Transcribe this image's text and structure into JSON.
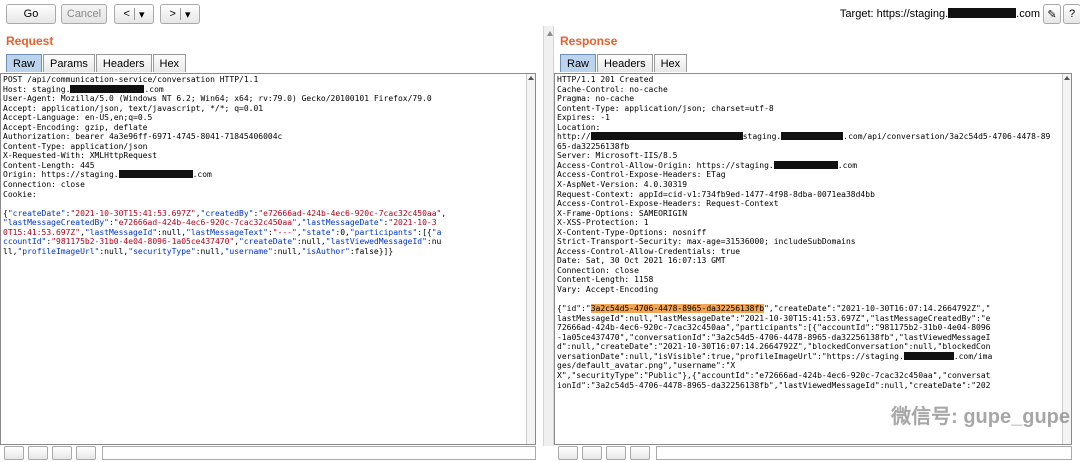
{
  "toolbar": {
    "go_label": "Go",
    "cancel_label": "Cancel",
    "back_label": "<",
    "back_menu_label": "▾",
    "forward_label": ">",
    "forward_menu_label": "▾",
    "target_prefix": "Target: https://staging.",
    "target_suffix": ".com"
  },
  "request": {
    "title": "Request",
    "tabs": [
      "Raw",
      "Params",
      "Headers",
      "Hex"
    ],
    "active_tab": "Raw",
    "lines": [
      {
        "parts": [
          {
            "t": "POST /api/communication-service/conversation HTTP/1.1"
          }
        ]
      },
      {
        "parts": [
          {
            "t": "Host: staging."
          },
          {
            "mask": 74
          },
          {
            "t": ".com"
          }
        ]
      },
      {
        "parts": [
          {
            "t": "User-Agent: Mozilla/5.0 (Windows NT 6.2; Win64; x64; rv:79.0) Gecko/20100101 Firefox/79.0"
          }
        ]
      },
      {
        "parts": [
          {
            "t": "Accept: application/json, text/javascript, */*; q=0.01"
          }
        ]
      },
      {
        "parts": [
          {
            "t": "Accept-Language: en-US,en;q=0.5"
          }
        ]
      },
      {
        "parts": [
          {
            "t": "Accept-Encoding: gzip, deflate"
          }
        ]
      },
      {
        "parts": [
          {
            "t": "Authorization: bearer 4a3e96ff-6971-4745-8041-71845406004c"
          }
        ]
      },
      {
        "parts": [
          {
            "t": "Content-Type: application/json"
          }
        ]
      },
      {
        "parts": [
          {
            "t": "X-Requested-With: XMLHttpRequest"
          }
        ]
      },
      {
        "parts": [
          {
            "t": "Content-Length: 445"
          }
        ]
      },
      {
        "parts": [
          {
            "t": "Origin: https://staging."
          },
          {
            "mask": 74
          },
          {
            "t": ".com"
          }
        ]
      },
      {
        "parts": [
          {
            "t": "Connection: close"
          }
        ]
      },
      {
        "parts": [
          {
            "t": "Cookie:"
          }
        ]
      },
      {
        "parts": [
          {
            "t": ""
          }
        ]
      },
      {
        "parts": [
          {
            "t": "{"
          },
          {
            "k": "\"createDate\""
          },
          {
            "t": ":"
          },
          {
            "s": "\"2021-10-30T15:41:53.697Z\""
          },
          {
            "t": ","
          },
          {
            "k": "\"createdBy\""
          },
          {
            "t": ":"
          },
          {
            "s": "\"e72666ad-424b-4ec6-920c-7cac32c450aa\""
          },
          {
            "t": ","
          }
        ]
      },
      {
        "parts": [
          {
            "k": "\"lastMessageCreatedBy\""
          },
          {
            "t": ":"
          },
          {
            "s": "\"e72666ad-424b-4ec6-920c-7cac32c450aa\""
          },
          {
            "t": ","
          },
          {
            "k": "\"lastMessageDate\""
          },
          {
            "t": ":"
          },
          {
            "s": "\"2021-10-3"
          }
        ]
      },
      {
        "parts": [
          {
            "s": "0T15:41:53.697Z\""
          },
          {
            "t": ","
          },
          {
            "k": "\"lastMessageId\""
          },
          {
            "t": ":null,"
          },
          {
            "k": "\"lastMessageText\""
          },
          {
            "t": ":"
          },
          {
            "s": "\"---\""
          },
          {
            "t": ","
          },
          {
            "k": "\"state\""
          },
          {
            "t": ":0,"
          },
          {
            "k": "\"participants\""
          },
          {
            "t": ":[{"
          },
          {
            "k": "\"a"
          }
        ]
      },
      {
        "parts": [
          {
            "k": "ccountId\""
          },
          {
            "t": ":"
          },
          {
            "s": "\"981175b2-31b0-4e04-8096-1a05ce437470\""
          },
          {
            "t": ","
          },
          {
            "k": "\"createDate\""
          },
          {
            "t": ":null,"
          },
          {
            "k": "\"lastViewedMessageId\""
          },
          {
            "t": ":nu"
          }
        ]
      },
      {
        "parts": [
          {
            "t": "ll,"
          },
          {
            "k": "\"profileImageUrl\""
          },
          {
            "t": ":null,"
          },
          {
            "k": "\"securityType\""
          },
          {
            "t": ":null,"
          },
          {
            "k": "\"username\""
          },
          {
            "t": ":null,"
          },
          {
            "k": "\"isAuthor\""
          },
          {
            "t": ":false}]}"
          }
        ]
      }
    ]
  },
  "response": {
    "title": "Response",
    "tabs": [
      "Raw",
      "Headers",
      "Hex"
    ],
    "active_tab": "Raw",
    "lines": [
      {
        "parts": [
          {
            "t": "HTTP/1.1 201 Created"
          }
        ]
      },
      {
        "parts": [
          {
            "t": "Cache-Control: no-cache"
          }
        ]
      },
      {
        "parts": [
          {
            "t": "Pragma: no-cache"
          }
        ]
      },
      {
        "parts": [
          {
            "t": "Content-Type: application/json; charset=utf-8"
          }
        ]
      },
      {
        "parts": [
          {
            "t": "Expires: -1"
          }
        ]
      },
      {
        "parts": [
          {
            "t": "Location:"
          }
        ]
      },
      {
        "parts": [
          {
            "t": "http://"
          },
          {
            "mask": 152
          },
          {
            "t": "staging."
          },
          {
            "mask": 62
          },
          {
            "t": ".com/api/conversation/3a2c54d5-4706-4478-89"
          }
        ]
      },
      {
        "parts": [
          {
            "t": "65-da32256138fb"
          }
        ]
      },
      {
        "parts": [
          {
            "t": "Server: Microsoft-IIS/8.5"
          }
        ]
      },
      {
        "parts": [
          {
            "t": "Access-Control-Allow-Origin: https://staging."
          },
          {
            "mask": 64
          },
          {
            "t": ".com"
          }
        ]
      },
      {
        "parts": [
          {
            "t": "Access-Control-Expose-Headers: ETag"
          }
        ]
      },
      {
        "parts": [
          {
            "t": "X-AspNet-Version: 4.0.30319"
          }
        ]
      },
      {
        "parts": [
          {
            "t": "Request-Context: appId=cid-v1:734fb9ed-1477-4f98-8dba-0071ea38d4bb"
          }
        ]
      },
      {
        "parts": [
          {
            "t": "Access-Control-Expose-Headers: Request-Context"
          }
        ]
      },
      {
        "parts": [
          {
            "t": "X-Frame-Options: SAMEORIGIN"
          }
        ]
      },
      {
        "parts": [
          {
            "t": "X-XSS-Protection: 1"
          }
        ]
      },
      {
        "parts": [
          {
            "t": "X-Content-Type-Options: nosniff"
          }
        ]
      },
      {
        "parts": [
          {
            "t": "Strict-Transport-Security: max-age=31536000; includeSubDomains"
          }
        ]
      },
      {
        "parts": [
          {
            "t": "Access-Control-Allow-Credentials: true"
          }
        ]
      },
      {
        "parts": [
          {
            "t": "Date: Sat, 30 Oct 2021 16:07:13 GMT"
          }
        ]
      },
      {
        "parts": [
          {
            "t": "Connection: close"
          }
        ]
      },
      {
        "parts": [
          {
            "t": "Content-Length: 1158"
          }
        ]
      },
      {
        "parts": [
          {
            "t": "Vary: Accept-Encoding"
          }
        ]
      },
      {
        "parts": [
          {
            "t": ""
          }
        ]
      },
      {
        "parts": [
          {
            "t": "{\"id\":\""
          },
          {
            "hl": "3a2c54d5-4706-4478-8965-da32256138fb"
          },
          {
            "t": "\",\"createDate\":\"2021-10-30T16:07:14.2664792Z\",\""
          }
        ]
      },
      {
        "parts": [
          {
            "t": "lastMessageId\":null,\"lastMessageDate\":\"2021-10-30T15:41:53.697Z\",\"lastMessageCreatedBy\":\"e"
          }
        ]
      },
      {
        "parts": [
          {
            "t": "72666ad-424b-4ec6-920c-7cac32c450aa\",\"participants\":[{\"accountId\":\"981175b2-31b0-4e04-8096"
          }
        ]
      },
      {
        "parts": [
          {
            "t": "-1a05ce437470\",\"conversationId\":\"3a2c54d5-4706-4478-8965-da32256138fb\",\"lastViewedMessageI"
          }
        ]
      },
      {
        "parts": [
          {
            "t": "d\":null,\"createDate\":\"2021-10-30T16:07:14.2664792Z\",\"blockedConversation\":null,\"blockedCon"
          }
        ]
      },
      {
        "parts": [
          {
            "t": "versationDate\":null,\"isVisible\":true,\"profileImageUrl\":\"https://staging."
          },
          {
            "mask": 50
          },
          {
            "t": ".com/ima"
          }
        ]
      },
      {
        "parts": [
          {
            "t": "ges/default_avatar.png\",\"username\":\"X"
          }
        ]
      },
      {
        "parts": [
          {
            "t": "X\",\"securityType\":\"Public\"},{\"accountId\":\"e72666ad-424b-4ec6-920c-7cac32c450aa\",\"conversat"
          }
        ]
      },
      {
        "parts": [
          {
            "t": "ionId\":\"3a2c54d5-4706-4478-8965-da32256138fb\",\"lastViewedMessageId\":null,\"createDate\":\"202"
          }
        ]
      }
    ]
  },
  "watermark_text": "微信号: gupe_gupe"
}
